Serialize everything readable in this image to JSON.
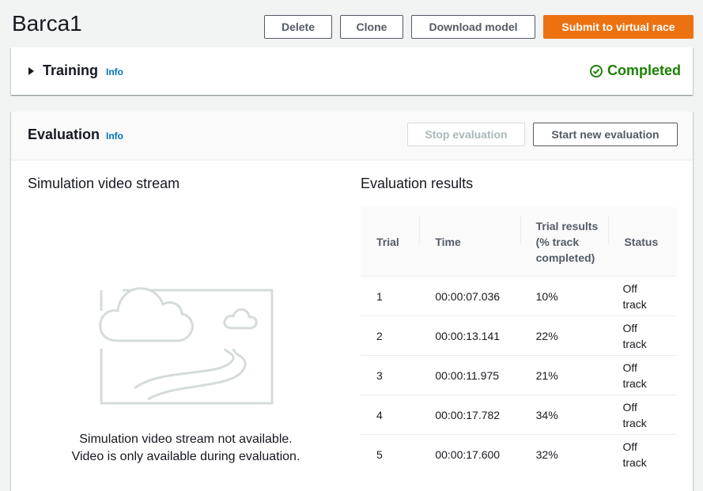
{
  "header": {
    "title": "Barca1",
    "buttons": {
      "delete": "Delete",
      "clone": "Clone",
      "download": "Download model",
      "submit": "Submit to virtual race"
    }
  },
  "training": {
    "title": "Training",
    "info": "Info",
    "status": "Completed",
    "status_icon": "check-circle-icon",
    "status_color": "#1d8102"
  },
  "evaluation": {
    "title": "Evaluation",
    "info": "Info",
    "stop_label": "Stop evaluation",
    "start_label": "Start new evaluation",
    "video": {
      "heading": "Simulation video stream",
      "msg_line1": "Simulation video stream not available.",
      "msg_line2": "Video is only available during evaluation."
    },
    "results": {
      "heading": "Evaluation results",
      "columns": {
        "trial": "Trial",
        "time": "Time",
        "res1": "Trial results",
        "res2": "(% track",
        "res3": "completed)",
        "status": "Status"
      },
      "rows": [
        {
          "trial": "1",
          "time": "00:00:07.036",
          "result": "10%",
          "status1": "Off",
          "status2": "track"
        },
        {
          "trial": "2",
          "time": "00:00:13.141",
          "result": "22%",
          "status1": "Off",
          "status2": "track"
        },
        {
          "trial": "3",
          "time": "00:00:11.975",
          "result": "21%",
          "status1": "Off",
          "status2": "track"
        },
        {
          "trial": "4",
          "time": "00:00:17.782",
          "result": "34%",
          "status1": "Off",
          "status2": "track"
        },
        {
          "trial": "5",
          "time": "00:00:17.600",
          "result": "32%",
          "status1": "Off",
          "status2": "track"
        }
      ]
    }
  },
  "colors": {
    "primary": "#ec7211",
    "link": "#0073bb",
    "success": "#1d8102"
  }
}
